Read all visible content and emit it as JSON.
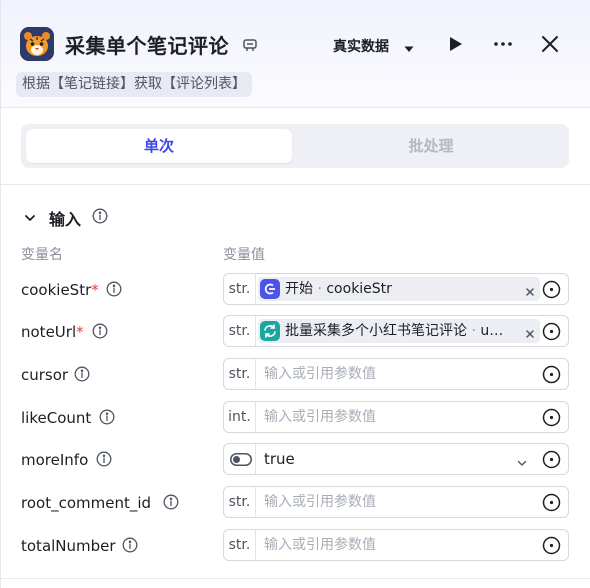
{
  "header": {
    "title": "采集单个笔记评论",
    "mode_label": "真实数据",
    "description": "根据【笔记链接】获取【评论列表】"
  },
  "tabs": [
    {
      "label": "单次",
      "active": true
    },
    {
      "label": "批处理",
      "active": false
    }
  ],
  "input_section": {
    "title": "输入",
    "col_name": "变量名",
    "col_value": "变量值",
    "rows": [
      {
        "name": "cookieStr",
        "required": true,
        "type": "str.",
        "kind": "ref",
        "ref_node": "开始",
        "ref_var": "cookieStr",
        "ref_color": "#4d53e8"
      },
      {
        "name": "noteUrl",
        "required": true,
        "type": "str.",
        "kind": "ref",
        "ref_node": "批量采集多个小红书笔记评论",
        "ref_var": "u…",
        "ref_color": "#1ba7a0"
      },
      {
        "name": "cursor",
        "required": false,
        "type": "str.",
        "kind": "empty",
        "placeholder": "输入或引用参数值"
      },
      {
        "name": "likeCount",
        "required": false,
        "type": "int.",
        "kind": "empty",
        "placeholder": "输入或引用参数值"
      },
      {
        "name": "moreInfo",
        "required": false,
        "type": "",
        "kind": "select",
        "value": "true"
      },
      {
        "name": "root_comment_id",
        "required": false,
        "type": "str.",
        "kind": "empty",
        "placeholder": "输入或引用参数值"
      },
      {
        "name": "totalNumber",
        "required": false,
        "type": "str.",
        "kind": "empty",
        "placeholder": "输入或引用参数值"
      }
    ]
  },
  "colors": {
    "accent": "#3c49e6",
    "required": "#e5413a"
  }
}
